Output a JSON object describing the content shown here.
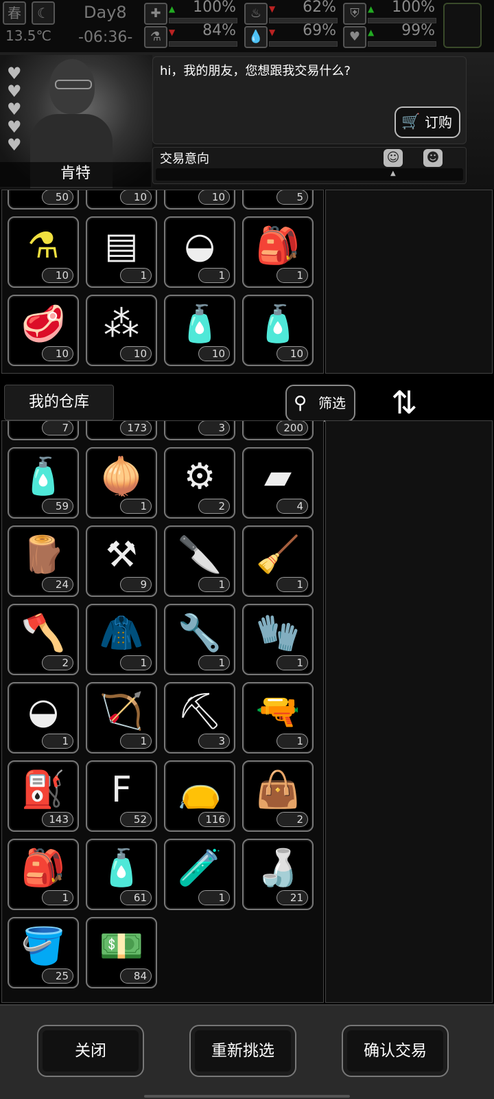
{
  "status": {
    "season": "春",
    "day": "Day8",
    "temperature": "13.5℃",
    "time": "-06:36-",
    "stats": [
      {
        "icon": "medkit-icon",
        "value": "100%",
        "trend": "up",
        "glyph": "✚"
      },
      {
        "icon": "stomach-icon",
        "value": "62%",
        "trend": "down",
        "glyph": "♨"
      },
      {
        "icon": "shield-icon",
        "value": "100%",
        "trend": "up",
        "glyph": "⛨"
      },
      {
        "icon": "flask-icon",
        "value": "84%",
        "trend": "down",
        "glyph": "⚗"
      },
      {
        "icon": "water-drop-icon",
        "value": "69%",
        "trend": "down",
        "glyph": "💧"
      },
      {
        "icon": "heart-icon",
        "value": "99%",
        "trend": "up",
        "glyph": "♥"
      }
    ]
  },
  "npc": {
    "name": "肯特",
    "hearts": [
      "♥",
      "♥",
      "♥",
      "♥",
      "♥"
    ],
    "dialog": "hi，我的朋友，您想跟我交易什么?",
    "order_label": "订购",
    "intent_label": "交易意向"
  },
  "shop_items": [
    {
      "icon": "item-icon",
      "glyph": "✿",
      "count": "50"
    },
    {
      "icon": "item-icon",
      "glyph": "✿",
      "count": "10"
    },
    {
      "icon": "item-icon",
      "glyph": "✿",
      "count": "10"
    },
    {
      "icon": "item-icon",
      "glyph": "✿",
      "count": "5"
    },
    {
      "icon": "flask-icon",
      "glyph": "⚗",
      "count": "10"
    },
    {
      "icon": "jerrycan-icon",
      "glyph": "▤",
      "count": "1"
    },
    {
      "icon": "frisbee-icon",
      "glyph": "◒",
      "count": "1"
    },
    {
      "icon": "backpack-icon",
      "glyph": "🎒",
      "count": "1"
    },
    {
      "icon": "meat-icon",
      "glyph": "🥩",
      "count": "10"
    },
    {
      "icon": "rubble-icon",
      "glyph": "⁂",
      "count": "10"
    },
    {
      "icon": "bottle-icon",
      "glyph": "🧴",
      "count": "10"
    },
    {
      "icon": "spray-bottle-icon",
      "glyph": "🧴",
      "count": "10"
    }
  ],
  "warehouse": {
    "title": "我的仓库",
    "filter_label": "筛选",
    "swap_glyph": "⇅",
    "items": [
      {
        "icon": "item-icon",
        "glyph": "◡",
        "count": "7"
      },
      {
        "icon": "item-icon",
        "glyph": "◡",
        "count": "173"
      },
      {
        "icon": "item-icon",
        "glyph": "◡",
        "count": "3"
      },
      {
        "icon": "item-icon",
        "glyph": "◡",
        "count": "200"
      },
      {
        "icon": "bottle-icon",
        "glyph": "🧴",
        "count": "59"
      },
      {
        "icon": "onion-icon",
        "glyph": "🧅",
        "count": "1"
      },
      {
        "icon": "gears-icon",
        "glyph": "⚙",
        "count": "2"
      },
      {
        "icon": "cloth-icon",
        "glyph": "▰",
        "count": "4"
      },
      {
        "icon": "log-icon",
        "glyph": "🪵",
        "count": "24"
      },
      {
        "icon": "screws-icon",
        "glyph": "⚒",
        "count": "9"
      },
      {
        "icon": "knife-icon",
        "glyph": "🔪",
        "count": "1"
      },
      {
        "icon": "scraper-icon",
        "glyph": "🧹",
        "count": "1"
      },
      {
        "icon": "axe-icon",
        "glyph": "🪓",
        "count": "2"
      },
      {
        "icon": "hoodie-icon",
        "glyph": "🧥",
        "count": "1"
      },
      {
        "icon": "pipe-wrench-icon",
        "glyph": "🔧",
        "count": "1"
      },
      {
        "icon": "gloves-icon",
        "glyph": "🧤",
        "count": "1"
      },
      {
        "icon": "frisbee-icon",
        "glyph": "◒",
        "count": "1"
      },
      {
        "icon": "crossbow-icon",
        "glyph": "🏹",
        "count": "1"
      },
      {
        "icon": "shovel-icon",
        "glyph": "⛏",
        "count": "3"
      },
      {
        "icon": "flare-gun-icon",
        "glyph": "🔫",
        "count": "1"
      },
      {
        "icon": "fuel-can-icon",
        "glyph": "⛽",
        "count": "143"
      },
      {
        "icon": "fertilizer-bag-icon",
        "glyph": "F",
        "count": "52"
      },
      {
        "icon": "sack-icon",
        "glyph": "👝",
        "count": "116"
      },
      {
        "icon": "tote-bag-icon",
        "glyph": "👜",
        "count": "2"
      },
      {
        "icon": "backpack-icon",
        "glyph": "🎒",
        "count": "1"
      },
      {
        "icon": "spray-bottle-icon",
        "glyph": "🧴",
        "count": "61"
      },
      {
        "icon": "ampoules-icon",
        "glyph": "🧪",
        "count": "1"
      },
      {
        "icon": "water-bottle-icon",
        "glyph": "🍶",
        "count": "21"
      },
      {
        "icon": "bucket-icon",
        "glyph": "🪣",
        "count": "25"
      },
      {
        "icon": "cash-bundle-icon",
        "glyph": "💵",
        "count": "84"
      }
    ]
  },
  "buttons": {
    "close": "关闭",
    "reselect": "重新挑选",
    "confirm": "确认交易"
  }
}
